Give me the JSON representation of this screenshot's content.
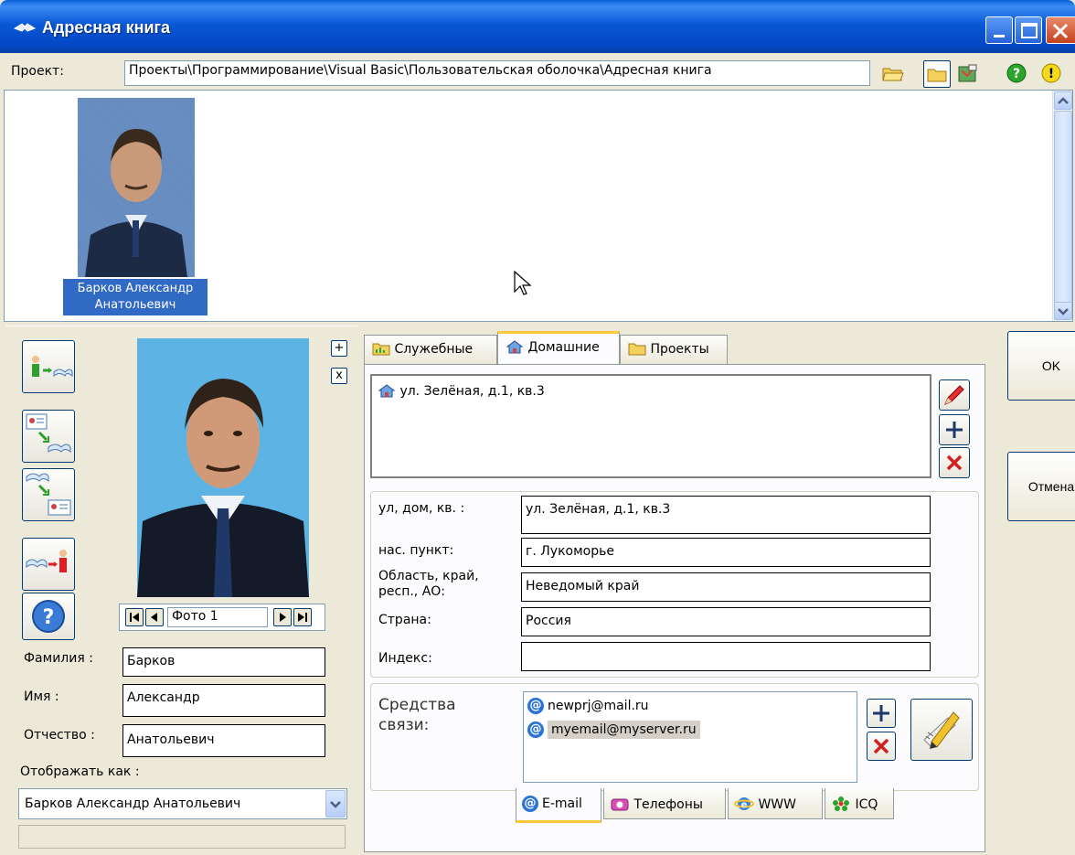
{
  "window": {
    "title": "Адресная книга"
  },
  "project": {
    "label": "Проект:",
    "path": "Проекты\\Программирование\\Visual Basic\\Пользовательская оболочка\\Адресная книга"
  },
  "card": {
    "name_line1": "Барков Александр",
    "name_line2": "Анатольевич"
  },
  "photo_nav": {
    "label": "Фото 1"
  },
  "person": {
    "last_name_label": "Фамилия :",
    "last_name": "Барков",
    "first_name_label": "Имя :",
    "first_name": "Александр",
    "patronymic_label": "Отчество :",
    "patronymic": "Анатольевич",
    "display_as_label": "Отображать как :",
    "display_as": "Барков Александр Анатольевич"
  },
  "mini_buttons": {
    "add": "+",
    "remove": "x"
  },
  "tabs": [
    "Служебные",
    "Домашние",
    "Проекты"
  ],
  "addresses": {
    "items": [
      "ул. Зелёная, д.1, кв.3"
    ]
  },
  "address_form": {
    "street_label": "ул, дом, кв. :",
    "street": "ул. Зелёная, д.1, кв.3",
    "city_label": "нас. пункт:",
    "city": "г. Лукоморье",
    "region_label_1": "Область, край,",
    "region_label_2": "респ., АО:",
    "region": "Неведомый край",
    "country_label": "Страна:",
    "country": "Россия",
    "zip_label": "Индекс:",
    "zip": ""
  },
  "contacts": {
    "label_1": "Средства",
    "label_2": "связи:",
    "emails": [
      "newprj@mail.ru",
      "myemail@myserver.ru"
    ]
  },
  "contact_tabs": [
    "E-mail",
    "Телефоны",
    "WWW",
    "ICQ"
  ],
  "buttons": {
    "ok": "OK",
    "cancel": "Отмена"
  }
}
